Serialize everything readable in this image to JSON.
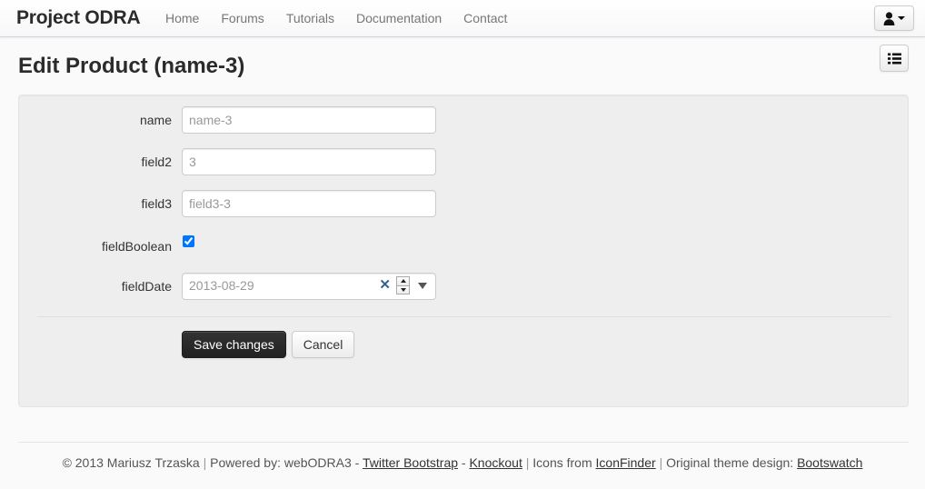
{
  "navbar": {
    "brand": "Project ODRA",
    "links": [
      {
        "label": "Home"
      },
      {
        "label": "Forums"
      },
      {
        "label": "Tutorials"
      },
      {
        "label": "Documentation"
      },
      {
        "label": "Contact"
      }
    ],
    "user_menu": {
      "icon": "user-icon",
      "caret": "caret-down-icon"
    }
  },
  "page": {
    "title": "Edit Product (name-3)",
    "list_button": {
      "icon": "list-icon"
    }
  },
  "form": {
    "fields": [
      {
        "label": "name",
        "type": "text",
        "value": "name-3",
        "placeholder": "name-3"
      },
      {
        "label": "field2",
        "type": "text",
        "value": "3",
        "placeholder": "3"
      },
      {
        "label": "field3",
        "type": "text",
        "value": "field3-3",
        "placeholder": "field3-3"
      },
      {
        "label": "fieldBoolean",
        "type": "checkbox",
        "checked": true
      },
      {
        "label": "fieldDate",
        "type": "date",
        "value": "2013-08-29",
        "clear_icon": "clear-x-icon",
        "spinner_icon": "spinner-icon",
        "caret_icon": "caret-down-icon"
      }
    ],
    "save_label": "Save changes",
    "cancel_label": "Cancel"
  },
  "footer": {
    "copyright": "© 2013 Mariusz Trzaska",
    "sep1": "|",
    "powered_by": "Powered by: webODRA3 -",
    "link_bootstrap": "Twitter Bootstrap",
    "dash1": "-",
    "link_knockout": "Knockout",
    "sep2": "|",
    "icons_from": "Icons from",
    "link_iconfinder": "IconFinder",
    "sep3": "|",
    "theme_design": "Original theme design:",
    "link_bootswatch": "Bootswatch"
  },
  "colors": {
    "navbar_bg": "#f7f7f9",
    "well_bg": "#eeeeee",
    "primary_btn": "#222222",
    "accent_blue": "#36648b",
    "page_bg": "#fafafa"
  }
}
